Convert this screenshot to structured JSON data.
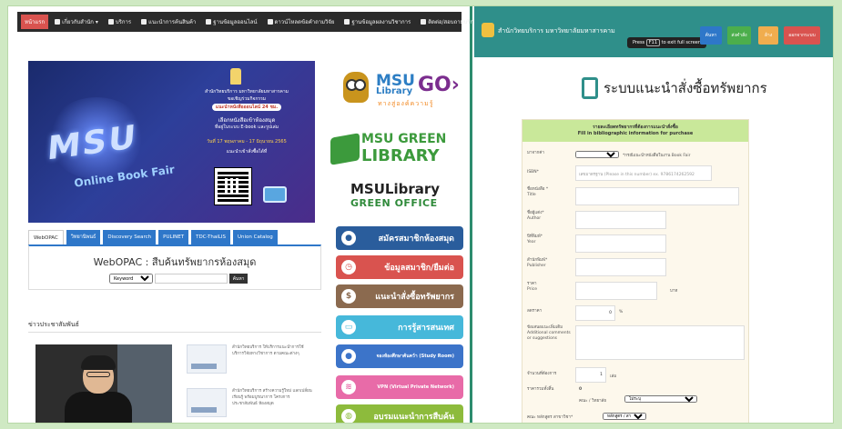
{
  "left": {
    "nav": [
      {
        "label": "หน้าแรก",
        "active": true
      },
      {
        "label": "เกี่ยวกับสำนัก ▾"
      },
      {
        "label": "บริการ"
      },
      {
        "label": "แนะนำการค้นสินค้า"
      },
      {
        "label": "ฐานข้อมูลออนไลน์"
      },
      {
        "label": "ดาวน์โหลดข้อคำถามวิจัย"
      },
      {
        "label": "ฐานข้อมูลผลงานวิชาการ"
      },
      {
        "label": "ติดต่อ/สอบถามบริการ"
      }
    ],
    "banner": {
      "big": "MSU",
      "fair": "Online Book Fair",
      "line1": "สำนักวิทยบริการ มหาวิทยาลัยมหาสารคาม",
      "line2": "ขอเชิญร่วมกิจกรรม",
      "highlight": "แนะนำหนังสือออนไลน์ 24 ชม.",
      "line3": "เลือกหนังสือเข้าห้องสมุด",
      "line4": "ที่อยู่ในระบบ E-book และรูปเล่ม",
      "dates": "วันที่ 17 พฤษภาคม - 17 มิถุนายน 2565",
      "line5": "แนะนำเข้าสั่งซื้อได้ที่"
    },
    "logos": {
      "msu": "MSU",
      "library": "Library",
      "go": "GO›",
      "tagline": "ทางสู่องค์ความรู้",
      "green1": "MSU GREEN",
      "green2": "LIBRARY",
      "office1": "MSULibrary",
      "office2": "GREEN OFFICE"
    },
    "side_buttons": [
      {
        "label": "สมัครสมาชิกห้องสมุด",
        "icon": "person-icon",
        "color": "#2a5d9c"
      },
      {
        "label": "ข้อมูลสมาชิก/ยืมต่อ",
        "icon": "clock-icon",
        "color": "#d9534f"
      },
      {
        "label": "แนะนำสั่งซื้อทรัพยากร",
        "icon": "dollar-icon",
        "color": "#8b6a4f"
      },
      {
        "label": "การรู้สารสนเทศ",
        "icon": "id-card-icon",
        "color": "#46b8da"
      },
      {
        "label": "จองห้องศึกษาค้นคว้า (Study Room)",
        "icon": "person-icon",
        "color": "#3c74c9"
      },
      {
        "label": "VPN (Virtual Private Network)",
        "icon": "wifi-icon",
        "color": "#e86ba8"
      },
      {
        "label": "อบรมแนะนำการสืบค้น",
        "icon": "globe-icon",
        "color": "#8dbb3c"
      }
    ],
    "tabs": [
      "WebOPAC",
      "วิทยานิพนธ์",
      "Discovery Search",
      "PULINET",
      "TDC-ThaiLIS",
      "Union Catalog"
    ],
    "webopac": {
      "title": "WebOPAC : สืบค้นทรัพยากรห้องสมุด",
      "select": "Keyword",
      "button": "ค้นหา"
    },
    "news_heading": "ข่าวประชาสัมพันธ์",
    "news": [
      "สำนักวิทยบริการ ให้บริการแนะนำการใช้ บริการวิจัยทางวิชาการ ตามคณะต่างๆ",
      "สำนักวิทยบริการ สร้างความรู้ใหม่ แลกเปลี่ยนเรียนรู้ พร้อมบูรณาการ โครงการ ประชาสัมพันธ์ ห้องสมุด"
    ]
  },
  "right": {
    "site": "สำนักวิทยบริการ มหาวิทยาลัยมหาสารคาม",
    "fullscreen_press": "Press",
    "fullscreen_key": "F11",
    "fullscreen_rest": "to exit full screen",
    "buttons": [
      {
        "label": "ค้นหา",
        "color": "#2e77c9"
      },
      {
        "label": "ส่งคำสั่ง",
        "color": "#4cae4c"
      },
      {
        "label": "ล้าง",
        "color": "#f0ad4e"
      },
      {
        "label": "ออกจากระบบ",
        "color": "#d9534f"
      }
    ],
    "page_title": "ระบบแนะนำสั่งซื้อทรัพยากร",
    "form_header_th": "รายละเอียดทรัพยากรที่ต้องการแนะนำสั่งซื้อ",
    "form_header_en": "Fill in bibliographic information for purchase",
    "fields": {
      "source_label": "มาจากค่า",
      "source_note": "*กรณีแนะนำหนังสือในงาน Book Fair",
      "isbn_label": "ISBN*",
      "isbn_placeholder": "เลขมาตรฐาน (Please in this number) ex. 9786174262592",
      "title_label": "ชื่อหนังสือ *",
      "title_sub": "Title",
      "author_label": "ชื่อผู้แต่ง*",
      "author_sub": "Author",
      "year_label": "ปีที่พิมพ์*",
      "year_sub": "Year",
      "publisher_label": "สำนักพิมพ์*",
      "publisher_sub": "Publisher",
      "price_label": "ราคา",
      "price_sub": "Price",
      "price_unit": "บาท",
      "discount_label": "ลดราคา",
      "discount_value": "0",
      "discount_unit": "%",
      "comment_label": "ข้อเสนอแนะเพิ่มเติม",
      "comment_sub": "Additional comments or suggestions",
      "qty_label": "จำนวนที่ต้องการ",
      "qty_value": "1",
      "qty_unit": "เล่ม",
      "total_label": "ราคารวมทั้งสิ้น",
      "total_value": "0",
      "faculty_label": "คณะ / วิทยาลัย",
      "faculty_value": "ไม่ระบุ",
      "program_label": "คณะ หลักสูตร สาขาวิชา*",
      "program_value": "หลักสูตร / สาขาวิชา"
    }
  }
}
